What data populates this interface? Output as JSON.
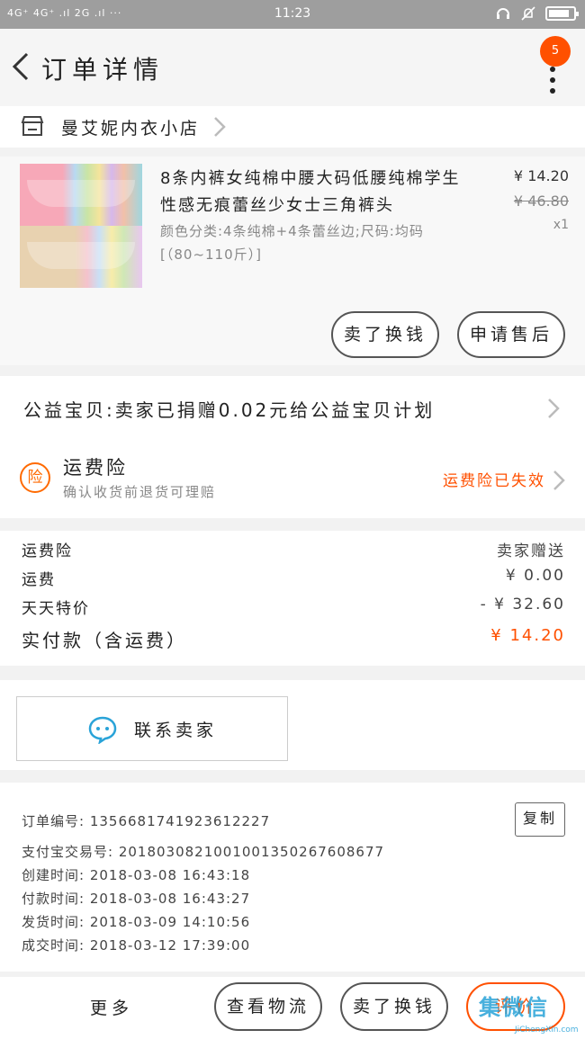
{
  "status_bar": {
    "network": "4G⁺ 4G⁺ .ıl 2G .ıl ···",
    "time": "11:23",
    "battery_level": 0.85
  },
  "nav": {
    "title": "订单详情",
    "badge": "5"
  },
  "shop": {
    "name": "曼艾妮内衣小店"
  },
  "product": {
    "title": "8条内裤女纯棉中腰大码低腰纯棉学生性感无痕蕾丝少女士三角裤头",
    "sku": "颜色分类:4条纯棉+4条蕾丝边;尺码:均码[（80~110斤）]",
    "price": "¥ 14.20",
    "original_price": "¥ 46.80",
    "quantity": "x1",
    "btn_refund": "卖了换钱",
    "btn_after_sale": "申请售后"
  },
  "charity": {
    "text": "公益宝贝:卖家已捐赠0.02元给公益宝贝计划"
  },
  "insurance": {
    "title": "运费险",
    "subtitle": "确认收货前退货可理赔",
    "status": "运费险已失效"
  },
  "summary": {
    "rows": [
      {
        "label": "运费险",
        "value": "卖家赠送"
      },
      {
        "label": "运费",
        "value": "¥ 0.00"
      },
      {
        "label": "天天特价",
        "value": "- ¥ 32.60"
      }
    ],
    "total_label": "实付款（含运费）",
    "total_value": "¥ 14.20"
  },
  "contact": {
    "label": "联系卖家"
  },
  "order_info": {
    "order_no": "订单编号: 1356681741923612227",
    "copy_label": "复制",
    "alipay_no": "支付宝交易号: 2018030821001001350267608677",
    "created": "创建时间: 2018-03-08  16:43:18",
    "paid": "付款时间: 2018-03-08  16:43:27",
    "shipped": "发货时间: 2018-03-09  14:10:56",
    "completed": "成交时间: 2018-03-12  17:39:00"
  },
  "bottom": {
    "more_label": "更多",
    "logistics_label": "查看物流",
    "resell_label": "卖了换钱",
    "review_label": "评价"
  },
  "watermark": {
    "text": "集微信",
    "sub": "JiChengXin.com"
  },
  "colors": {
    "accent": "#ff5000",
    "contact_icon": "#29a3d8"
  }
}
